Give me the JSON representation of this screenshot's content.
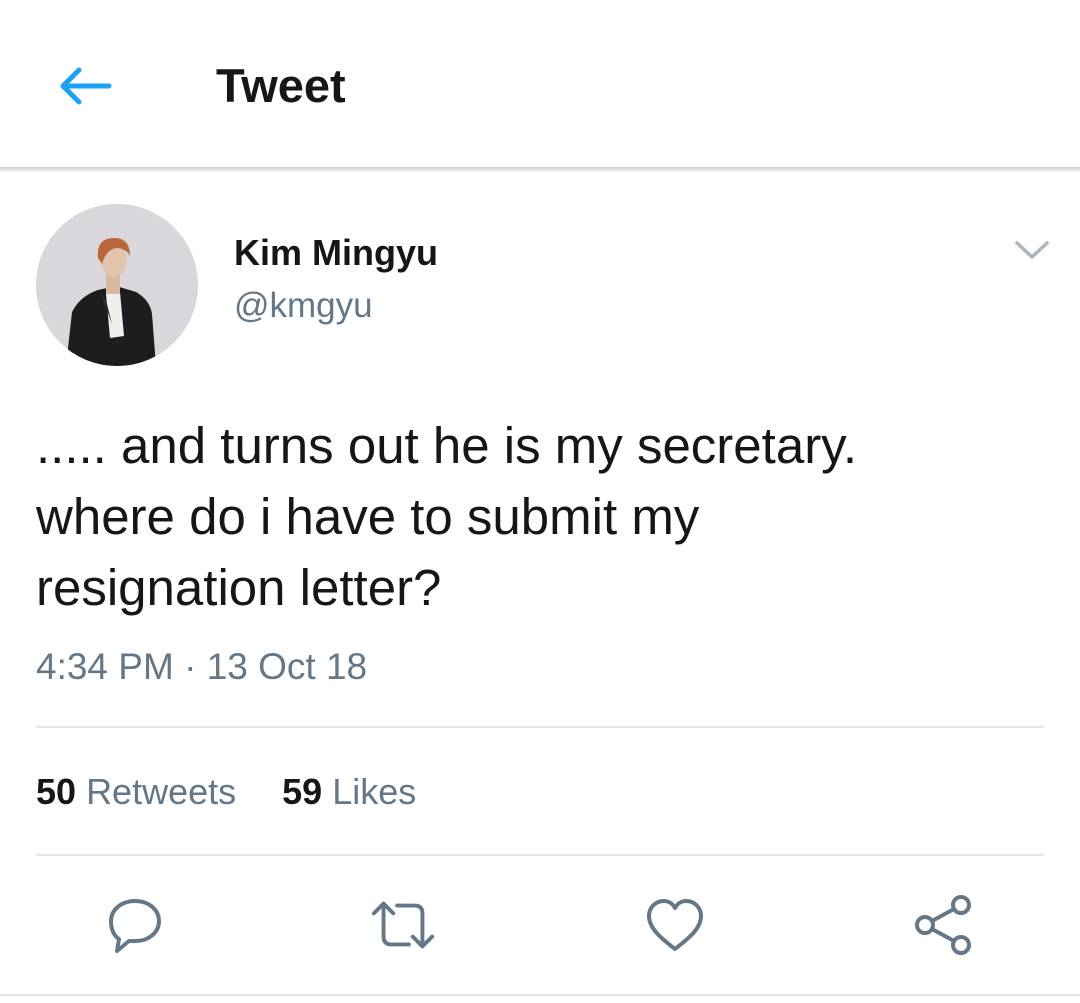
{
  "header": {
    "title": "Tweet",
    "back_icon": "arrow-left-icon"
  },
  "tweet": {
    "author": {
      "display_name": "Kim Mingyu",
      "handle": "@kmgyu"
    },
    "menu_icon": "chevron-down-icon",
    "text_lines": [
      "..... and turns out he is my secretary.",
      "where do i have to submit my",
      "resignation letter?"
    ],
    "time": "4:34 PM",
    "separator": "·",
    "date": "13 Oct 18"
  },
  "stats": {
    "retweets_count": "50",
    "retweets_label": "Retweets",
    "likes_count": "59",
    "likes_label": "Likes"
  },
  "actions": {
    "reply_icon": "reply-icon",
    "retweet_icon": "retweet-icon",
    "like_icon": "heart-icon",
    "share_icon": "share-icon"
  },
  "colors": {
    "accent": "#1DA1F2",
    "text_primary": "#14171A",
    "text_secondary": "#657786",
    "divider": "#E1E8ED"
  }
}
